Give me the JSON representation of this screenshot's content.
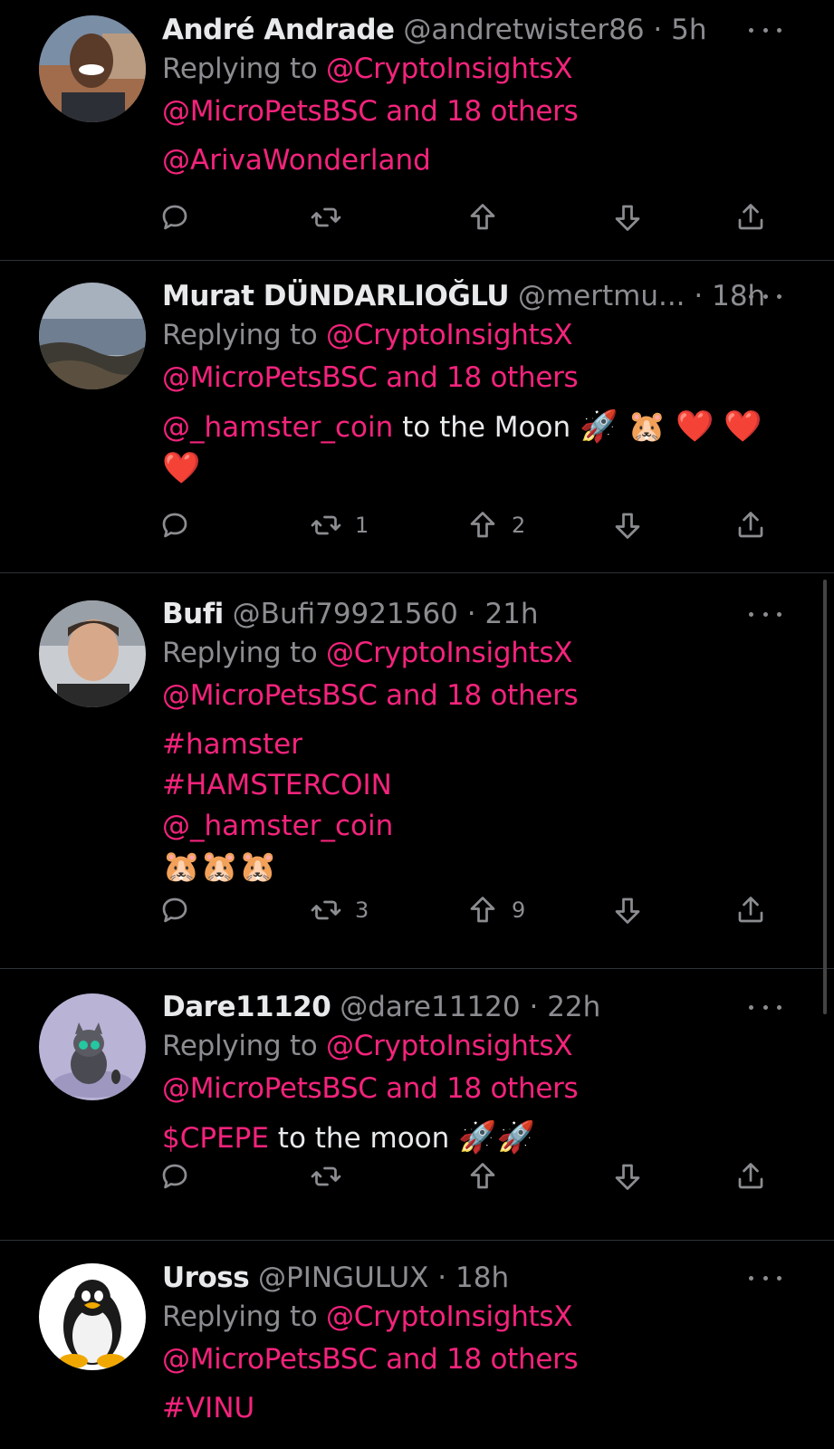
{
  "replying_label": "Replying to",
  "tweets": [
    {
      "name": "André Andrade",
      "handle": "@andretwister86",
      "time": "5h",
      "reply_to_1": "@CryptoInsightsX",
      "reply_to_2": "@MicroPetsBSC and 18 others",
      "body_link": "@ArivaWonderland",
      "retweets": "",
      "upvotes": ""
    },
    {
      "name": "Murat DÜNDARLIOĞLU",
      "handle": "@mertmu...",
      "time": "18h",
      "reply_to_1": "@CryptoInsightsX",
      "reply_to_2": "@MicroPetsBSC and 18 others",
      "body_link": "@_hamster_coin",
      "body_text": " to the Moon ",
      "body_emoji_1": "🚀 🐹 ❤️ ❤️",
      "body_emoji_2": "❤️",
      "retweets": "1",
      "upvotes": "2"
    },
    {
      "name": "Bufi",
      "handle": "@Bufi79921560",
      "time": "21h",
      "reply_to_1": "@CryptoInsightsX",
      "reply_to_2": "@MicroPetsBSC and 18 others",
      "body_line_1": "#hamster",
      "body_line_2": "#HAMSTERCOIN",
      "body_line_3": "@_hamster_coin",
      "body_emoji": "🐹🐹🐹",
      "retweets": "3",
      "upvotes": "9"
    },
    {
      "name": "Dare11120",
      "handle": "@dare11120",
      "time": "22h",
      "reply_to_1": "@CryptoInsightsX",
      "reply_to_2": "@MicroPetsBSC and 18 others",
      "body_link": "$CPEPE",
      "body_text": " to the moon ",
      "body_emoji": "🚀🚀",
      "retweets": "",
      "upvotes": ""
    },
    {
      "name": "Uross",
      "handle": "@PINGULUX",
      "time": "18h",
      "reply_to_1": "@CryptoInsightsX",
      "reply_to_2": "@MicroPetsBSC and 18 others",
      "body_link": "#VINU"
    }
  ],
  "icons": {
    "reply": "reply-icon",
    "retweet": "retweet-icon",
    "upvote": "upvote-icon",
    "downvote": "downvote-icon",
    "share": "share-icon",
    "more": "more-icon"
  },
  "colors": {
    "accent": "#f4237c",
    "muted": "#8b8d91",
    "text": "#e7e9ea",
    "background": "#000000",
    "divider": "#2f3336"
  }
}
